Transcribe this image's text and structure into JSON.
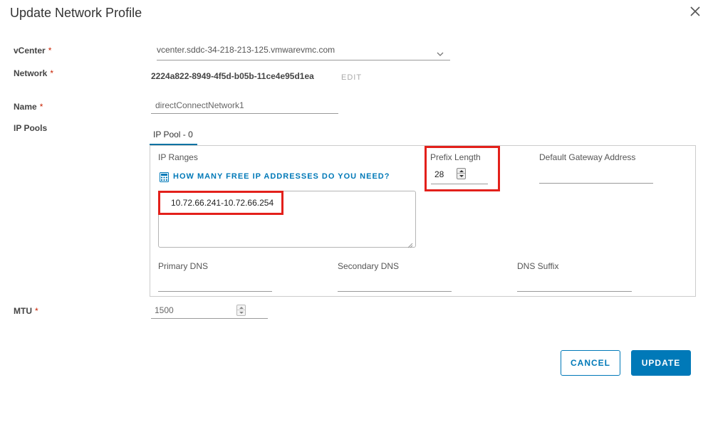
{
  "dialog": {
    "title": "Update Network Profile"
  },
  "form": {
    "required_marker": "*",
    "vcenter": {
      "label": "vCenter",
      "value": "vcenter.sddc-34-218-213-125.vmwarevmc.com"
    },
    "network": {
      "label": "Network",
      "value": "2224a822-8949-4f5d-b05b-11ce4e95d1ea",
      "edit_label": "EDIT"
    },
    "name": {
      "label": "Name",
      "value": "directConnectNetwork1"
    },
    "ip_pools": {
      "label": "IP Pools",
      "tabs": [
        {
          "label": "IP Pool - 0"
        }
      ],
      "ip_ranges": {
        "label": "IP Ranges",
        "helper_link": "HOW MANY FREE IP ADDRESSES DO YOU NEED?",
        "value": "10.72.66.241-10.72.66.254"
      },
      "prefix_length": {
        "label": "Prefix Length",
        "value": "28"
      },
      "default_gateway": {
        "label": "Default Gateway Address",
        "value": ""
      },
      "primary_dns": {
        "label": "Primary DNS",
        "value": ""
      },
      "secondary_dns": {
        "label": "Secondary DNS",
        "value": ""
      },
      "dns_suffix": {
        "label": "DNS Suffix",
        "value": ""
      }
    },
    "mtu": {
      "label": "MTU",
      "value": "1500"
    }
  },
  "actions": {
    "cancel_label": "CANCEL",
    "update_label": "UPDATE"
  },
  "colors": {
    "accent": "#0079b8",
    "highlight": "#e3201b",
    "required": "#c92100"
  }
}
